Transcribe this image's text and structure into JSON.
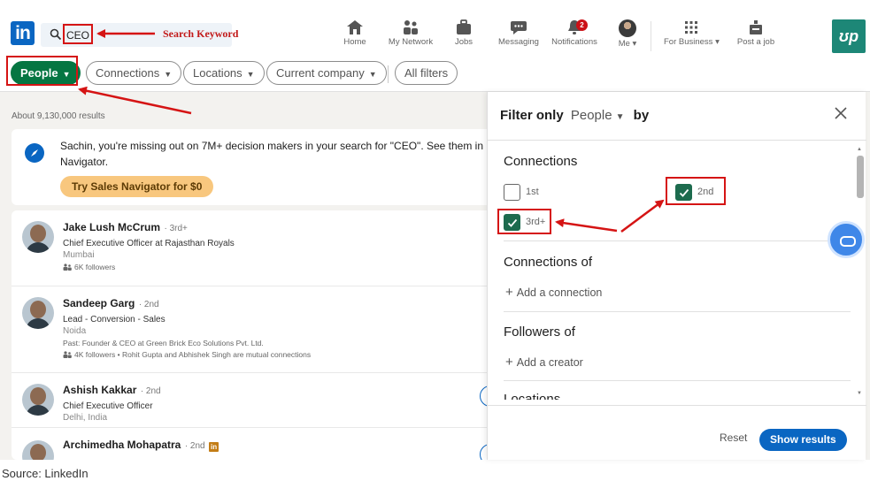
{
  "nav": {
    "logo_text": "in",
    "search_value": "CEO",
    "items": [
      {
        "label": "Home",
        "icon": "home-icon"
      },
      {
        "label": "My Network",
        "icon": "network-icon"
      },
      {
        "label": "Jobs",
        "icon": "briefcase-icon"
      },
      {
        "label": "Messaging",
        "icon": "message-icon"
      },
      {
        "label": "Notifications",
        "icon": "bell-icon",
        "badge": "2"
      },
      {
        "label": "Me",
        "icon": "avatar-icon",
        "caret": "▾"
      },
      {
        "label": "For Business",
        "icon": "grid-icon",
        "caret": "▾"
      },
      {
        "label": "Post a job",
        "icon": "post-job-icon"
      }
    ],
    "upwork_logo": "ʊp"
  },
  "filters": {
    "people": "People",
    "connections": "Connections",
    "locations": "Locations",
    "current_company": "Current company",
    "all_filters": "All filters"
  },
  "results": {
    "count_text": "About 9,130,000 results",
    "promo_text": "Sachin, you're missing out on 7M+ decision makers in your search for \"CEO\". See them in Navigator.",
    "promo_button": "Try Sales Navigator for $0",
    "people": [
      {
        "name": "Jake Lush McCrum",
        "degree": "· 3rd+",
        "headline": "Chief Executive Officer at Rajasthan Royals",
        "location": "Mumbai",
        "extra": "6K followers"
      },
      {
        "name": "Sandeep Garg",
        "degree": "· 2nd",
        "headline": "Lead - Conversion - Sales",
        "location": "Noida",
        "past": "Past: Founder & CEO at Green Brick Eco Solutions Pvt. Ltd.",
        "extra": "4K followers • Rohit Gupta and Abhishek Singh are mutual connections"
      },
      {
        "name": "Ashish Kakkar",
        "degree": "· 2nd",
        "headline": "Chief Executive Officer",
        "location": "Delhi, India"
      },
      {
        "name": "Archimedha Mohapatra",
        "degree": "· 2nd"
      }
    ]
  },
  "panel": {
    "title_prefix": "Filter only",
    "title_entity": "People",
    "title_suffix": "by",
    "connections_title": "Connections",
    "options": [
      {
        "label": "1st",
        "checked": false
      },
      {
        "label": "2nd",
        "checked": true
      },
      {
        "label": "3rd+",
        "checked": true
      }
    ],
    "connections_of_title": "Connections of",
    "add_connection": "Add a connection",
    "followers_of_title": "Followers of",
    "add_creator": "Add a creator",
    "locations_title": "Locations",
    "reset": "Reset",
    "show_results": "Show results"
  },
  "annotations": {
    "search_keyword": "Search Keyword",
    "color": "#d51414"
  },
  "caption": "Source: LinkedIn",
  "colors": {
    "linkedin_blue": "#0a66c2",
    "people_green": "#057642",
    "checkbox_green": "#1d6b4e",
    "promo_button": "#f8c77e"
  }
}
